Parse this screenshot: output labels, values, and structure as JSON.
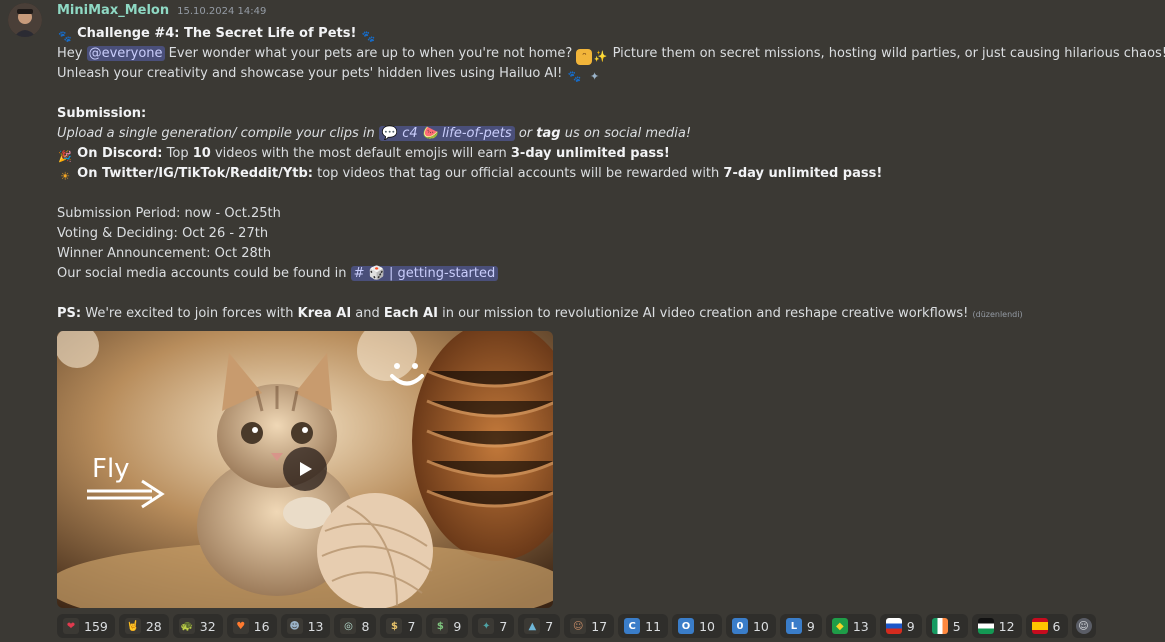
{
  "message": {
    "username": "MiniMax_Melon",
    "timestamp": "15.10.2024 14:49",
    "title": "Challenge #4: The Secret Life of Pets!",
    "intro_hey": "Hey",
    "mention": "@everyone",
    "intro_1": "Ever wonder what your pets are up to when you're not home?",
    "intro_2": "Picture them on secret missions, hosting wild parties, or just causing hilarious chaos!",
    "intro_3": "Unleash your creativity and showcase your pets' hidden lives using Hailuo AI!",
    "submission_label": "Submission:",
    "upload_text": "Upload a single generation/ compile your clips in",
    "channel_life": "c4 🍉 life-of-pets",
    "or_text": "or",
    "tag_word": "tag",
    "upload_tail": "us on social media!",
    "discord_label": "On Discord:",
    "discord_t1": "Top",
    "discord_num": "10",
    "discord_t2": "videos with the most default emojis will earn",
    "discord_prize": "3-day unlimited pass!",
    "twitter_label": "On Twitter/IG/TikTok/Reddit/Ytb:",
    "twitter_text": "top videos that tag our official accounts will be rewarded with",
    "twitter_prize": "7-day unlimited pass!",
    "period": "Submission Period: now - Oct.25th",
    "voting": "Voting & Deciding: Oct 26 - 27th",
    "winner": "Winner Announcement: Oct 28th",
    "social": "Our social media accounts could be found in",
    "channel_started": "getting-started",
    "ps_label": "PS:",
    "ps_1": "We're excited to join forces with",
    "krea": "Krea AI",
    "and_word": "and",
    "each": "Each AI",
    "ps_2": "in our mission to revolutionize AI video creation and reshape creative workflows!",
    "edited": "(düzenlendi)"
  },
  "video": {
    "overlay_text": "Fly"
  },
  "reactions": [
    {
      "icon": "heart-icon",
      "glyph": "❤",
      "bg": "#3b3934",
      "color": "#e03a4e",
      "count": "159"
    },
    {
      "icon": "rock-hand-icon",
      "glyph": "🤘",
      "bg": "#3b3934",
      "color": "#f5c542",
      "count": "28"
    },
    {
      "icon": "turtle-icon",
      "glyph": "🐢",
      "bg": "#3b3934",
      "color": "#6cc24a",
      "count": "32"
    },
    {
      "icon": "fire-heart-icon",
      "glyph": "♥",
      "bg": "#3b3934",
      "color": "#ff7a2f",
      "count": "16"
    },
    {
      "icon": "custom-emoji-icon",
      "glyph": "☻",
      "bg": "#3b3934",
      "color": "#9ab3c9",
      "count": "13"
    },
    {
      "icon": "custom-emoji-icon",
      "glyph": "◎",
      "bg": "#3b3934",
      "color": "#b8e0d2",
      "count": "8"
    },
    {
      "icon": "money-bag-icon",
      "glyph": "$",
      "bg": "#3b3934",
      "color": "#e8c36a",
      "count": "7"
    },
    {
      "icon": "money-wings-icon",
      "glyph": "$",
      "bg": "#3b3934",
      "color": "#7ec47e",
      "count": "9"
    },
    {
      "icon": "custom-emoji-icon",
      "glyph": "✦",
      "bg": "#3b3934",
      "color": "#4fa3a5",
      "count": "7"
    },
    {
      "icon": "custom-emoji-icon",
      "glyph": "▲",
      "bg": "#3b3934",
      "color": "#6fb7d8",
      "count": "7"
    },
    {
      "icon": "custom-emoji-icon",
      "glyph": "☺",
      "bg": "#3b3934",
      "color": "#c98d67",
      "count": "17"
    },
    {
      "icon": "letter-c-icon",
      "glyph": "C",
      "bg": "#3a7dc9",
      "color": "#ffffff",
      "count": "11"
    },
    {
      "icon": "letter-o-icon",
      "glyph": "O",
      "bg": "#3a7dc9",
      "color": "#ffffff",
      "count": "10"
    },
    {
      "icon": "zero-icon",
      "glyph": "0",
      "bg": "#3a7dc9",
      "color": "#ffffff",
      "count": "10"
    },
    {
      "icon": "letter-l-icon",
      "glyph": "L",
      "bg": "#3a7dc9",
      "color": "#ffffff",
      "count": "9"
    },
    {
      "icon": "flag-brazil-icon",
      "glyph": "◆",
      "bg": "#1f9d48",
      "color": "#f7d428",
      "count": "13"
    },
    {
      "icon": "flag-russia-icon",
      "glyph": "",
      "bg": "linear-gradient(#ffffff 33%, #1c57c9 33%, #1c57c9 66%, #d52b1e 66%)",
      "color": "#ffffff",
      "count": "9"
    },
    {
      "icon": "flag-ireland-icon",
      "glyph": "",
      "bg": "linear-gradient(90deg, #169b62 33%, #ffffff 33%, #ffffff 66%, #ff883e 66%)",
      "color": "#ffffff",
      "count": "5"
    },
    {
      "icon": "flag-palestine-icon",
      "glyph": "",
      "bg": "linear-gradient(#111111 33%, #ffffff 33%, #ffffff 66%, #149954 66%)",
      "color": "#ffffff",
      "count": "12"
    },
    {
      "icon": "flag-spain-icon",
      "glyph": "",
      "bg": "linear-gradient(#c60b1e 25%, #ffc400 25%, #ffc400 75%, #c60b1e 75%)",
      "color": "#ffffff",
      "count": "6"
    },
    {
      "icon": "add-reaction-icon",
      "glyph": "☺",
      "bg": "#5a5d66",
      "color": "#dbdee1",
      "count": ""
    }
  ]
}
